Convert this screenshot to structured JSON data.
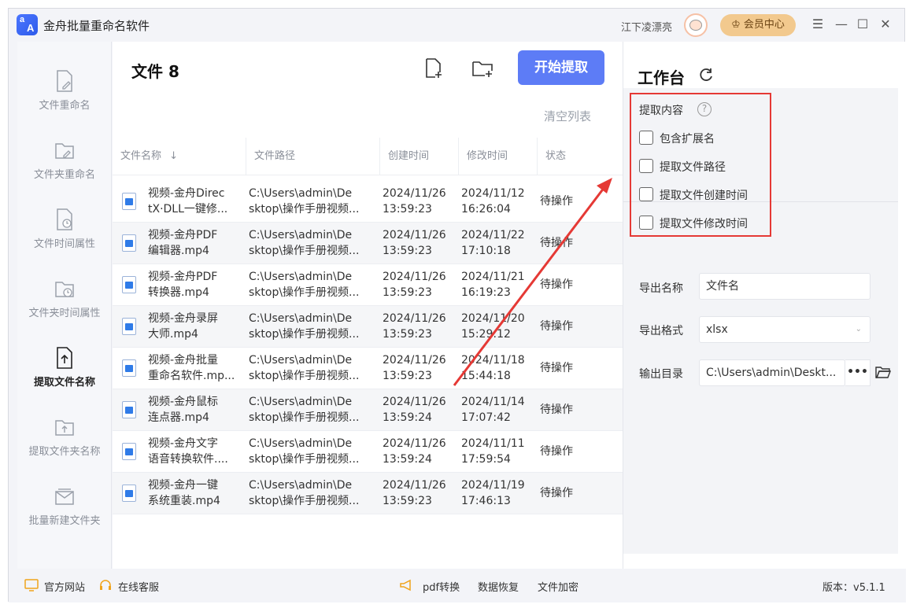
{
  "app": {
    "title": "金舟批量重命名软件",
    "user_name": "江下凌漂亮",
    "member_label": "会员中心"
  },
  "sidebar": {
    "items": [
      {
        "label": "文件重命名",
        "icon": "file-edit-icon"
      },
      {
        "label": "文件夹重命名",
        "icon": "folder-edit-icon"
      },
      {
        "label": "文件时间属性",
        "icon": "file-clock-icon"
      },
      {
        "label": "文件夹时间属性",
        "icon": "folder-clock-icon"
      },
      {
        "label": "提取文件名称",
        "icon": "file-upload-icon",
        "active": true
      },
      {
        "label": "提取文件夹名称",
        "icon": "folder-upload-icon"
      },
      {
        "label": "批量新建文件夹",
        "icon": "folder-mail-icon"
      }
    ]
  },
  "main": {
    "file_count_label": "文件 8",
    "start_button": "开始提取",
    "clear_list": "清空列表",
    "columns": [
      "文件名称",
      "文件路径",
      "创建时间",
      "修改时间",
      "状态"
    ],
    "sort_indicator": "↓",
    "rows": [
      {
        "name": [
          "视频-金舟Direc",
          "tX·DLL一键修..."
        ],
        "path": [
          "C:\\Users\\admin\\De",
          "sktop\\操作手册视频..."
        ],
        "created": [
          "2024/11/26",
          "13:59:23"
        ],
        "modified": [
          "2024/11/12",
          "16:26:04"
        ],
        "status": "待操作"
      },
      {
        "name": [
          "视频-金舟PDF",
          "编辑器.mp4"
        ],
        "path": [
          "C:\\Users\\admin\\De",
          "sktop\\操作手册视频..."
        ],
        "created": [
          "2024/11/26",
          "13:59:23"
        ],
        "modified": [
          "2024/11/22",
          "17:10:18"
        ],
        "status": "待操作"
      },
      {
        "name": [
          "视频-金舟PDF",
          "转换器.mp4"
        ],
        "path": [
          "C:\\Users\\admin\\De",
          "sktop\\操作手册视频..."
        ],
        "created": [
          "2024/11/26",
          "13:59:23"
        ],
        "modified": [
          "2024/11/21",
          "16:19:23"
        ],
        "status": "待操作"
      },
      {
        "name": [
          "视频-金舟录屏",
          "大师.mp4"
        ],
        "path": [
          "C:\\Users\\admin\\De",
          "sktop\\操作手册视频..."
        ],
        "created": [
          "2024/11/26",
          "13:59:23"
        ],
        "modified": [
          "2024/11/20",
          "15:29:12"
        ],
        "status": "待操作"
      },
      {
        "name": [
          "视频-金舟批量",
          "重命名软件.mp..."
        ],
        "path": [
          "C:\\Users\\admin\\De",
          "sktop\\操作手册视频..."
        ],
        "created": [
          "2024/11/26",
          "13:59:23"
        ],
        "modified": [
          "2024/11/18",
          "15:44:18"
        ],
        "status": "待操作"
      },
      {
        "name": [
          "视频-金舟鼠标",
          "连点器.mp4"
        ],
        "path": [
          "C:\\Users\\admin\\De",
          "sktop\\操作手册视频..."
        ],
        "created": [
          "2024/11/26",
          "13:59:24"
        ],
        "modified": [
          "2024/11/14",
          "17:07:42"
        ],
        "status": "待操作"
      },
      {
        "name": [
          "视频-金舟文字",
          "语音转换软件...."
        ],
        "path": [
          "C:\\Users\\admin\\De",
          "sktop\\操作手册视频..."
        ],
        "created": [
          "2024/11/26",
          "13:59:24"
        ],
        "modified": [
          "2024/11/11",
          "17:59:54"
        ],
        "status": "待操作"
      },
      {
        "name": [
          "视频-金舟一键",
          "系统重装.mp4"
        ],
        "path": [
          "C:\\Users\\admin\\De",
          "sktop\\操作手册视频..."
        ],
        "created": [
          "2024/11/26",
          "13:59:23"
        ],
        "modified": [
          "2024/11/19",
          "17:46:13"
        ],
        "status": "待操作"
      }
    ]
  },
  "workbench": {
    "title": "工作台",
    "extract_label": "提取内容",
    "options": [
      {
        "label": "包含扩展名",
        "checked": false
      },
      {
        "label": "提取文件路径",
        "checked": false
      },
      {
        "label": "提取文件创建时间",
        "checked": false
      },
      {
        "label": "提取文件修改时间",
        "checked": false
      }
    ],
    "export_name_label": "导出名称",
    "export_name_value": "文件名",
    "export_format_label": "导出格式",
    "export_format_value": "xlsx",
    "output_dir_label": "输出目录",
    "output_dir_value": "C:\\Users\\admin\\Deskt...",
    "more_label": "•••"
  },
  "footer": {
    "website": "官方网站",
    "support": "在线客服",
    "pdf": "pdf转换",
    "recovery": "数据恢复",
    "encrypt": "文件加密",
    "version": "版本：v5.1.1"
  },
  "colors": {
    "accent": "#5d7cf6",
    "highlight_box": "#e53935",
    "member": "#f2c98e"
  }
}
